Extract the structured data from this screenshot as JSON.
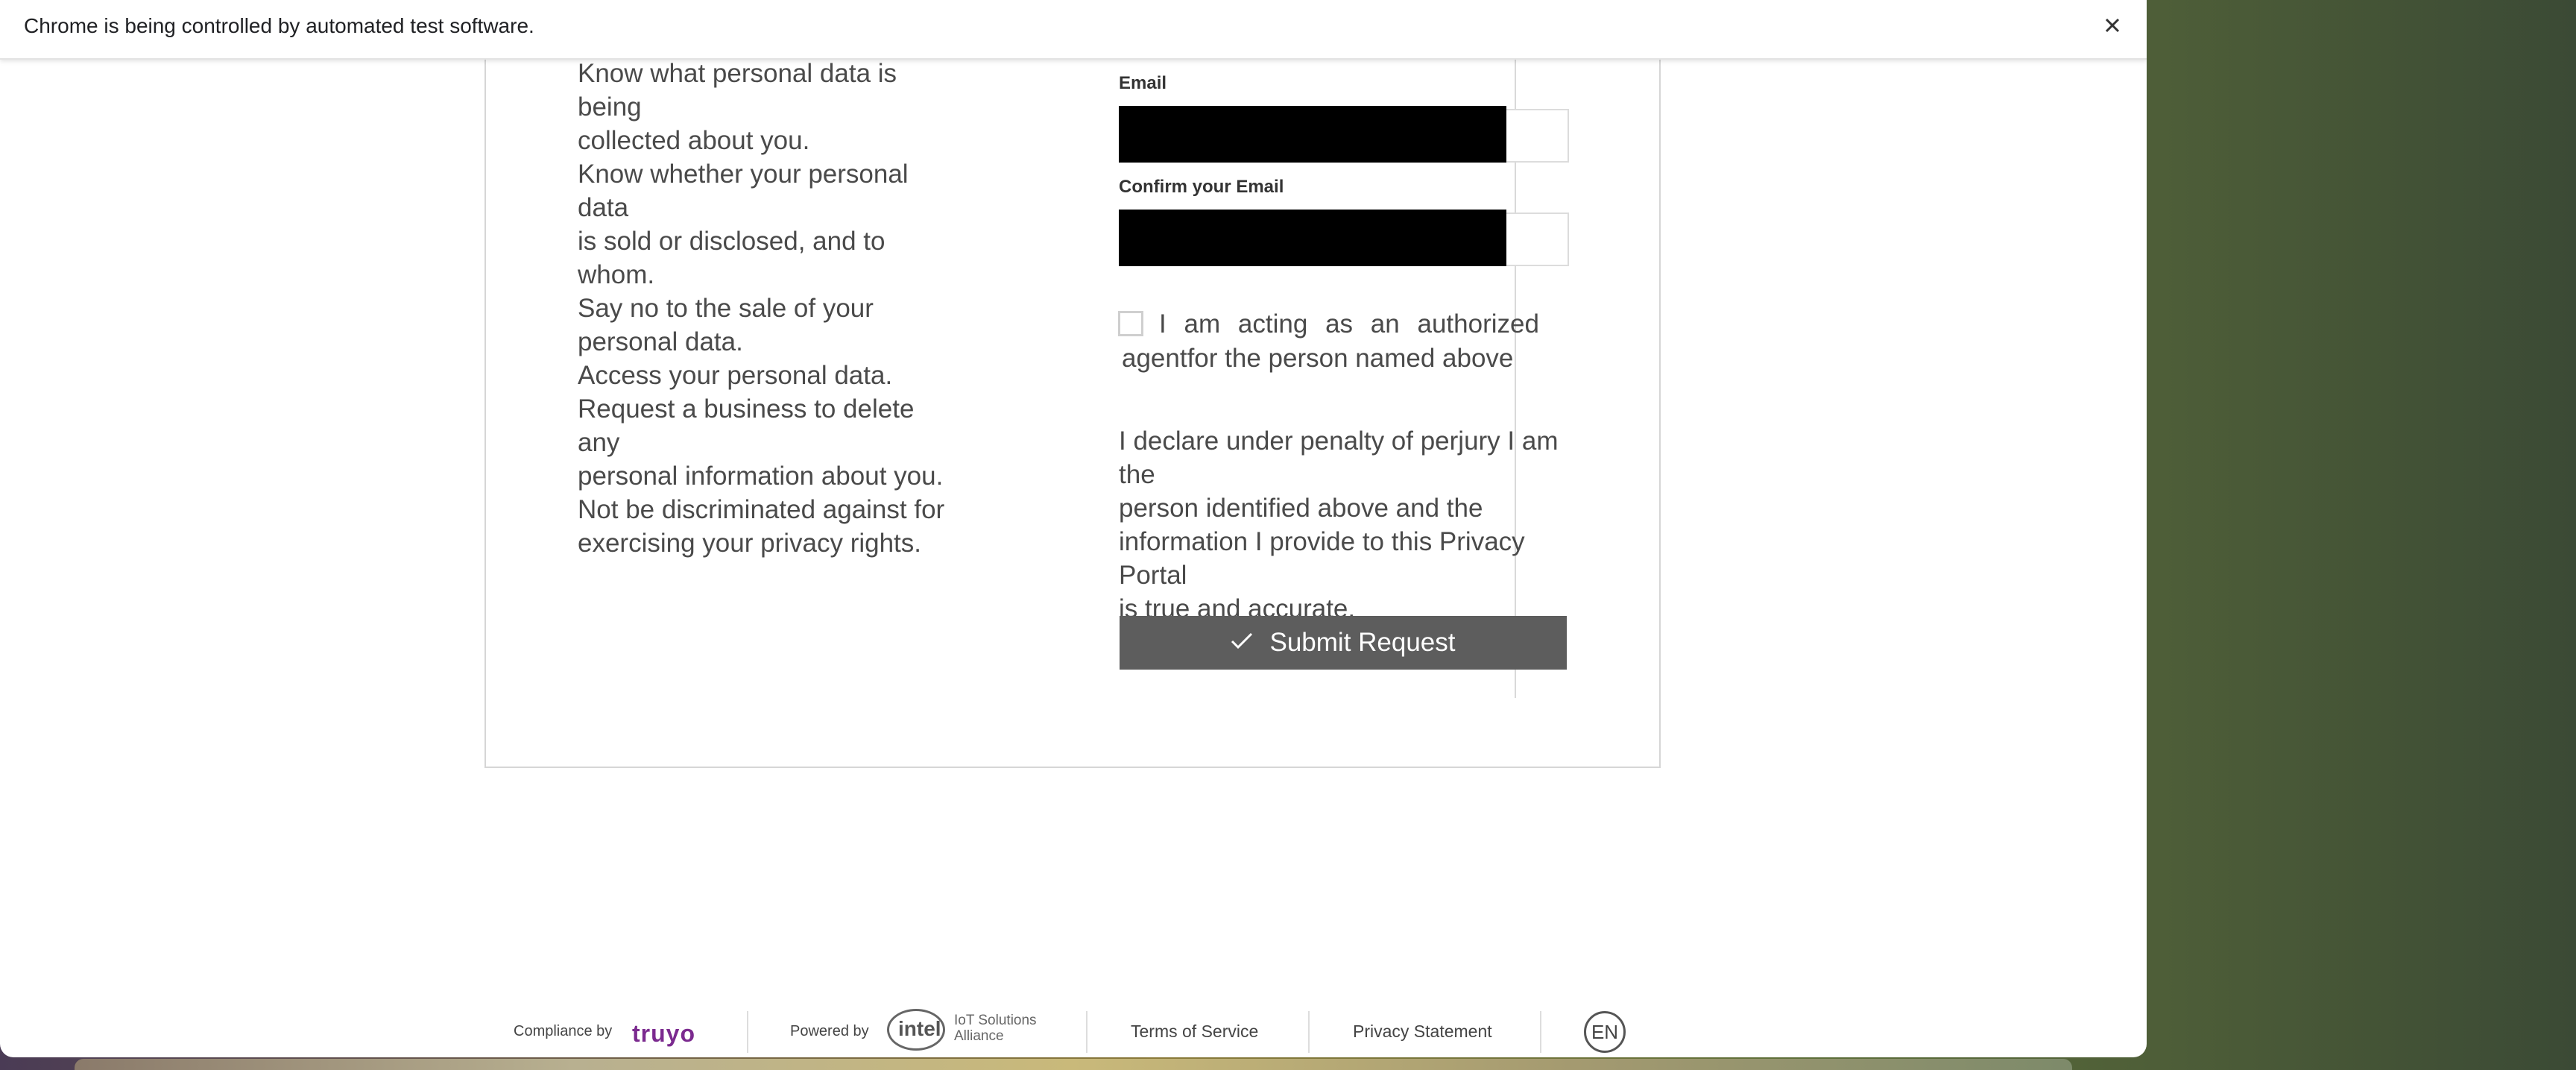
{
  "banner": {
    "text": "Chrome is being controlled by automated test software.",
    "close_icon": "close-icon"
  },
  "rights": {
    "lines": [
      "Know what personal data is being",
      "collected about you.",
      "Know whether your personal data",
      "is sold or disclosed, and to whom.",
      "Say no to the sale of your",
      "personal data.",
      "Access your personal data.",
      "Request a business to delete any",
      "personal information about you.",
      "Not be discriminated against for",
      "exercising your privacy rights."
    ]
  },
  "form": {
    "email_label": "Email",
    "confirm_email_label": "Confirm your Email",
    "agent_words": [
      "I",
      "am",
      "acting",
      "as",
      "an",
      "authorized"
    ],
    "agent_line2": "agentfor the person named above",
    "declaration_lines": [
      "I declare under penalty of perjury I am the",
      "person identified above and the",
      "information I provide to this Privacy Portal",
      "is true and accurate."
    ],
    "submit_label": "Submit Request",
    "submit_icon": "check-icon"
  },
  "footer": {
    "compliance_by": "Compliance by",
    "truyo": "truyo",
    "powered_by": "Powered by",
    "intel": "intel",
    "iot_line1": "IoT Solutions",
    "iot_line2": "Alliance",
    "terms": "Terms of Service",
    "privacy": "Privacy Statement",
    "language": "EN"
  },
  "colors": {
    "submit_bg": "#5d5d5d",
    "text": "#4a4a4a",
    "truyo_brand": "#7b2a8f"
  }
}
